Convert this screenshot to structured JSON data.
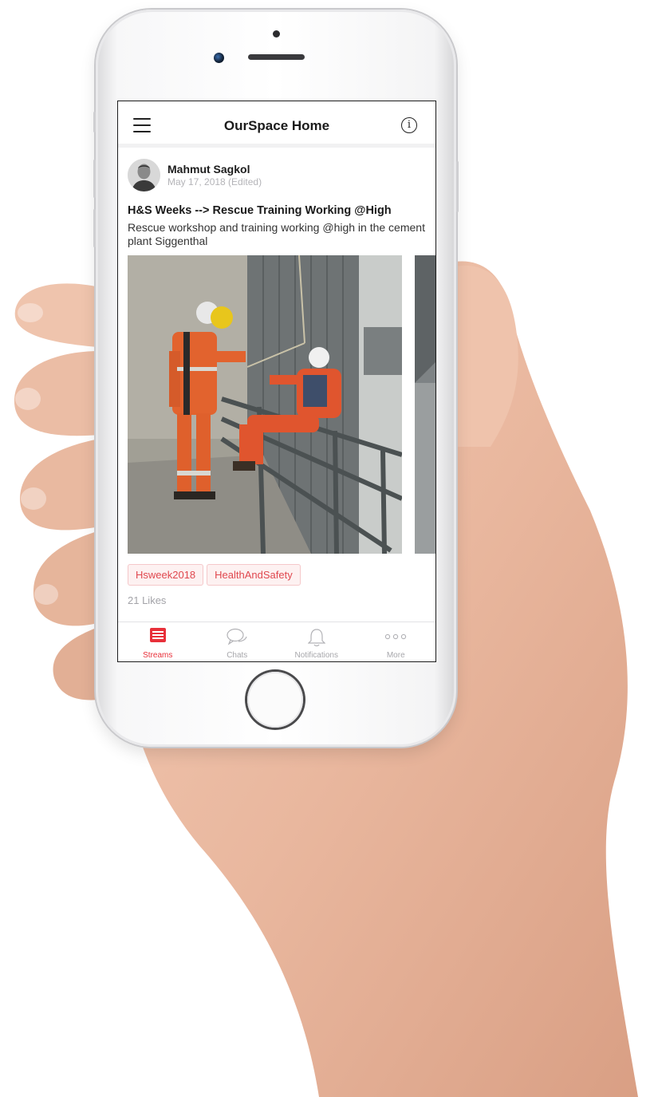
{
  "header": {
    "title": "OurSpace Home"
  },
  "post": {
    "author": "Mahmut Sagkol",
    "date": "May 17, 2018 (Edited)",
    "title": "H&S Weeks --> Rescue Training Working @High",
    "body": "Rescue workshop and training working @high in the cement plant Siggenthal",
    "tags": [
      "Hsweek2018",
      "HealthAndSafety"
    ],
    "likes": "21 Likes"
  },
  "tabbar": {
    "items": [
      {
        "label": "Streams",
        "icon": "streams-icon",
        "active": true
      },
      {
        "label": "Chats",
        "icon": "chat-bubbles-icon",
        "active": false
      },
      {
        "label": "Notifications",
        "icon": "bell-icon",
        "active": false
      },
      {
        "label": "More",
        "icon": "more-dots-icon",
        "active": false
      }
    ]
  },
  "colors": {
    "accent": "#e8303a",
    "tag_text": "#e0484f",
    "tag_background": "#fdf1f1"
  }
}
